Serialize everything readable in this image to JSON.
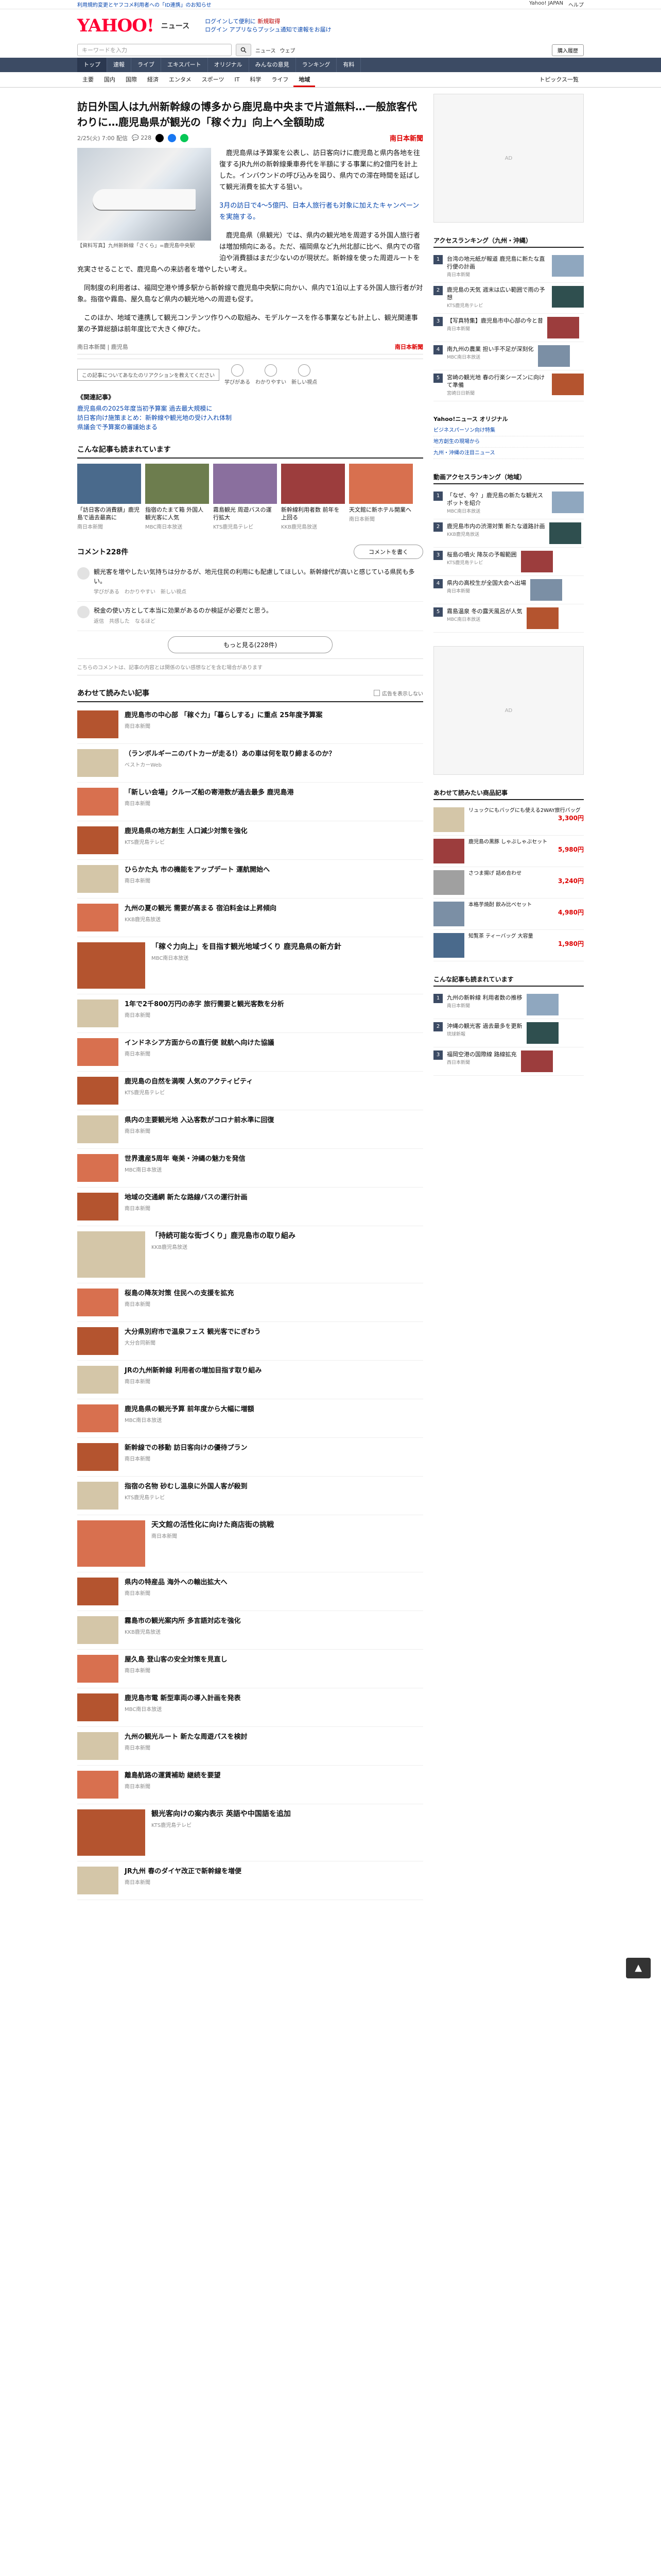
{
  "topbar": {
    "left": "利用規約変更とヤフコメ利用者への「ID連携」のお知らせ",
    "right": [
      "Yahoo! JAPAN",
      "ヘルプ"
    ]
  },
  "header": {
    "logo": "YAHOO!",
    "logo_sub": "ニュース",
    "links": [
      "ログインして便利に",
      "ログイン",
      "アプリならプッシュ通知で速報をお届け"
    ],
    "notice": "新規取得"
  },
  "search": {
    "placeholder": "キーワードを入力",
    "options": [
      "ニュース",
      "ウェブ"
    ],
    "login_label": "購入履歴"
  },
  "gnav": [
    "トップ",
    "速報",
    "ライブ",
    "エキスパート",
    "オリジナル",
    "みんなの意見",
    "ランキング",
    "有料"
  ],
  "gnav_active": 0,
  "snav": [
    "主要",
    "国内",
    "国際",
    "経済",
    "エンタメ",
    "スポーツ",
    "IT",
    "科学",
    "ライフ",
    "地域"
  ],
  "snav_active": 9,
  "snav_right": "トピックス一覧",
  "article": {
    "headline": "訪日外国人は九州新幹線の博多から鹿児島中央まで片道無料…一般旅客代わりに…鹿児島県が観光の「稼ぐ力」向上へ全額助成",
    "timestamp": "2/25(火) 7:00 配信",
    "comments_count": "228",
    "publisher": "南日本新聞",
    "image_caption": "【資料写真】九州新幹線「さくら」=鹿児島中央駅",
    "paragraphs": [
      "鹿児島県は予算案を公表し、訪日客向けに鹿児島と県内各地を往復するJR九州の新幹線乗車券代を半額にする事業に約2億円を計上した。インバウンドの呼び込みを図り、県内での滞在時間を延ばして観光消費を拡大する狙い。",
      "3月の訪日で4～5億円、日本人旅行者も対象に加えたキャンペーンを実施する。",
      "鹿児島県（県観光）では、県内の観光地を周遊する外国人旅行者は増加傾向にある。ただ、福岡県など九州北部に比べ、県内での宿泊や消費額はまだ少ないのが現状だ。新幹線を使った周遊ルートを充実させることで、鹿児島への来訪者を増やしたい考え。",
      "同制度の利用者は、福岡空港や博多駅から新幹線で鹿児島中央駅に向かい、県内で1泊以上する外国人旅行者が対象。指宿や霧島、屋久島など県内の観光地への周遊も促す。",
      "このほか、地域で連携して観光コンテンツ作りへの取組み、モデルケースを作る事業なども計上し、観光関連事業の予算総額は前年度比で大きく伸びた。"
    ],
    "link_line": "《関連記事》",
    "related": [
      "鹿児島県の2025年度当初予算案 過去最大規模に",
      "訪日客向け施策まとめ：新幹線や観光地の受け入れ体制",
      "県議会で予算案の審議始まる"
    ],
    "footer_left": "南日本新聞 | 鹿児島",
    "footer_right": "南日本新聞",
    "reaction_tip": "この記事についてあなたのリアクションを教えてください",
    "reactions": [
      "学びがある",
      "わかりやすい",
      "新しい視点"
    ]
  },
  "carousel_title": "こんな記事も読まれています",
  "carousel": [
    {
      "title": "「訪日客の消費額」鹿児島で過去最高に",
      "src": "南日本新聞"
    },
    {
      "title": "指宿のたまて箱 外国人観光客に人気",
      "src": "MBC南日本放送"
    },
    {
      "title": "霧島観光 周遊バスの運行拡大",
      "src": "KTS鹿児島テレビ"
    },
    {
      "title": "新幹線利用者数 前年を上回る",
      "src": "KKB鹿児島放送"
    },
    {
      "title": "天文館に新ホテル開業へ",
      "src": "南日本新聞"
    }
  ],
  "comments": {
    "title": "コメント228件",
    "button": "コメントを書く",
    "items": [
      {
        "text": "観光客を増やしたい気持ちは分かるが、地元住民の利用にも配慮してほしい。新幹線代が高いと感じている県民も多い。",
        "foot": [
          "学びがある",
          "わかりやすい",
          "新しい視点"
        ]
      },
      {
        "text": "税金の使い方として本当に効果があるのか検証が必要だと思う。",
        "foot": [
          "返信",
          "共感した",
          "なるほど"
        ]
      }
    ],
    "more": "もっと見る(228件)",
    "note": "こちらのコメントは、記事の内容とは関係のない感想などを含む場合があります"
  },
  "recs_title": "あわせて読みたい記事",
  "recs_option": "広告を表示しない",
  "recs": [
    {
      "title": "鹿児島市の中心部 「稼ぐ力」「暮らしする」に重点 25年度予算案",
      "src": "南日本新聞"
    },
    {
      "title": "（ランボルギーニのパトカーが走る!）あの車は何を取り締まるのか？",
      "src": "ベストカーWeb"
    },
    {
      "title": "「新しい会場」クルーズ船の寄港数が過去最多 鹿児島港",
      "src": "南日本新聞"
    },
    {
      "title": "鹿児島県の地方創生 人口減少対策を強化",
      "src": "KTS鹿児島テレビ"
    },
    {
      "title": "ひらかた丸 市の機能をアップデート 運航開始へ",
      "src": "南日本新聞"
    },
    {
      "title": "九州の夏の観光 需要が高まる 宿泊料金は上昇傾向",
      "src": "KKB鹿児島放送"
    },
    {
      "title": "「稼ぐ力向上」を目指す観光地域づくり 鹿児島県の新方針",
      "src": "MBC南日本放送"
    },
    {
      "title": "1年で2千800万円の赤字 旅行需要と観光客数を分析",
      "src": "南日本新聞"
    },
    {
      "title": "インドネシア方面からの直行便 就航へ向けた協議",
      "src": "南日本新聞"
    },
    {
      "title": "鹿児島の自然を満喫 人気のアクティビティ",
      "src": "KTS鹿児島テレビ"
    },
    {
      "title": "県内の主要観光地 入込客数がコロナ前水準に回復",
      "src": "南日本新聞"
    },
    {
      "title": "世界遺産5周年 奄美・沖縄の魅力を発信",
      "src": "MBC南日本放送"
    },
    {
      "title": "地域の交通網 新たな路線バスの運行計画",
      "src": "南日本新聞"
    },
    {
      "title": "「持続可能な街づくり」鹿児島市の取り組み",
      "src": "KKB鹿児島放送"
    },
    {
      "title": "桜島の降灰対策 住民への支援を拡充",
      "src": "南日本新聞"
    },
    {
      "title": "大分県別府市で温泉フェス 観光客でにぎわう",
      "src": "大分合同新聞"
    },
    {
      "title": "JRの九州新幹線 利用者の増加目指す取り組み",
      "src": "南日本新聞"
    },
    {
      "title": "鹿児島県の観光予算 前年度から大幅に増額",
      "src": "MBC南日本放送"
    },
    {
      "title": "新幹線での移動 訪日客向けの優待プラン",
      "src": "南日本新聞"
    },
    {
      "title": "指宿の名物 砂むし温泉に外国人客が殺到",
      "src": "KTS鹿児島テレビ"
    },
    {
      "title": "天文館の活性化に向けた商店街の挑戦",
      "src": "南日本新聞"
    },
    {
      "title": "県内の特産品 海外への輸出拡大へ",
      "src": "南日本新聞"
    },
    {
      "title": "霧島市の観光案内所 多言語対応を強化",
      "src": "KKB鹿児島放送"
    },
    {
      "title": "屋久島 登山客の安全対策を見直し",
      "src": "南日本新聞"
    },
    {
      "title": "鹿児島市電 新型車両の導入計画を発表",
      "src": "MBC南日本放送"
    },
    {
      "title": "九州の観光ルート 新たな周遊パスを検討",
      "src": "南日本新聞"
    },
    {
      "title": "離島航路の運賃補助 継続を要望",
      "src": "南日本新聞"
    },
    {
      "title": "観光客向けの案内表示 英語や中国語を追加",
      "src": "KTS鹿児島テレビ"
    },
    {
      "title": "JR九州 春のダイヤ改正で新幹線を増便",
      "src": "南日本新聞"
    }
  ],
  "sidebar": {
    "rank_title": "アクセスランキング（九州・沖縄）",
    "rank_sub": "",
    "rank": [
      {
        "title": "台湾の地元紙が報道 鹿児島に新たな直行便の計画",
        "src": "南日本新聞"
      },
      {
        "title": "鹿児島の天気 週末は広い範囲で雨の予想",
        "src": "KTS鹿児島テレビ"
      },
      {
        "title": "【写真特集】鹿児島市中心部の今と昔",
        "src": "南日本新聞"
      },
      {
        "title": "南九州の農業 担い手不足が深刻化",
        "src": "MBC南日本放送"
      },
      {
        "title": "宮崎の観光地 春の行楽シーズンに向けて準備",
        "src": "宮崎日日新聞"
      }
    ],
    "rn_title": "Yahoo!ニュース オリジナル",
    "rn_items": [
      "ビジネスパーソン向け特集",
      "地方創生の現場から",
      "九州・沖縄の注目ニュース"
    ],
    "rank2_title": "動画アクセスランキング（地域）",
    "rank2": [
      {
        "title": "「なぜ、今？」鹿児島の新たな観光スポットを紹介",
        "src": "MBC南日本放送"
      },
      {
        "title": "鹿児島市内の渋滞対策 新たな道路計画",
        "src": "KKB鹿児島放送"
      },
      {
        "title": "桜島の噴火 降灰の予報範囲",
        "src": "KTS鹿児島テレビ"
      },
      {
        "title": "県内の高校生が全国大会へ出場",
        "src": "南日本新聞"
      },
      {
        "title": "霧島温泉 冬の露天風呂が人気",
        "src": "MBC南日本放送"
      }
    ],
    "shop_title": "あわせて読みたい商品記事",
    "shop": [
      {
        "title": "リュックにもバッグにも使える2WAY旅行バッグ",
        "price": "3,300円"
      },
      {
        "title": "鹿児島の黒豚 しゃぶしゃぶセット",
        "price": "5,980円"
      },
      {
        "title": "さつま揚げ 詰め合わせ",
        "price": "3,240円"
      },
      {
        "title": "本格芋焼酎 飲み比べセット",
        "price": "4,980円"
      },
      {
        "title": "知覧茶 ティーバッグ 大容量",
        "price": "1,980円"
      }
    ],
    "rank3_title": "こんな記事も読まれています",
    "rank3": [
      {
        "title": "九州の新幹線 利用者数の推移",
        "src": "南日本新聞"
      },
      {
        "title": "沖縄の観光客 過去最多を更新",
        "src": "琉球新報"
      },
      {
        "title": "福岡空港の国際線 路線拡充",
        "src": "西日本新聞"
      }
    ]
  }
}
